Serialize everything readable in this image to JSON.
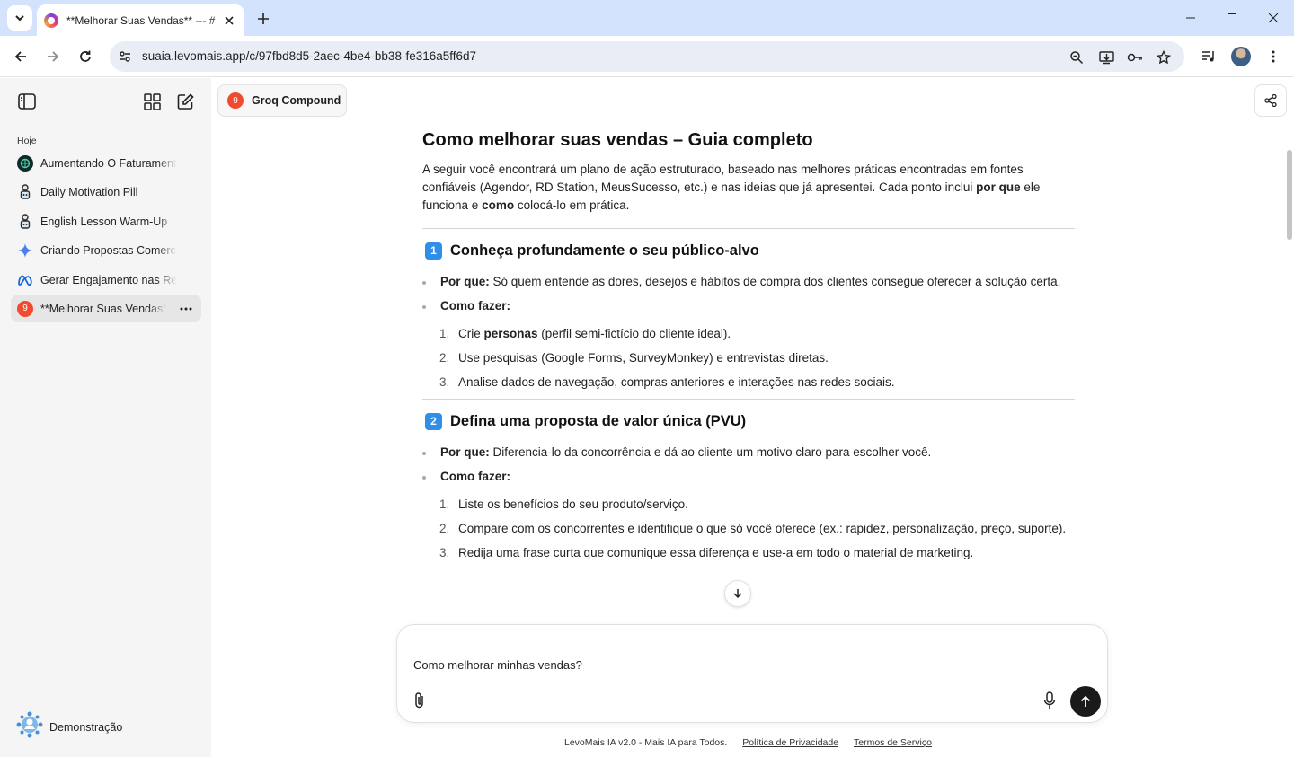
{
  "browser": {
    "tab_title": "**Melhorar Suas Vendas** --- #",
    "url": "suaia.levomais.app/c/97fbd8d5-2aec-4be4-bb38-fe316a5ff6d7"
  },
  "sidebar": {
    "section_label": "Hoje",
    "chats": [
      {
        "label": "Aumentando O Faturamento E",
        "icon": "openai-icon"
      },
      {
        "label": "Daily Motivation Pill",
        "icon": "agent-icon"
      },
      {
        "label": "English Lesson Warm-Up",
        "icon": "agent-icon"
      },
      {
        "label": "Criando Propostas Comerciais",
        "icon": "gemini-icon"
      },
      {
        "label": "Gerar Engajamento nas Redes",
        "icon": "meta-icon"
      },
      {
        "label": "**Melhorar Suas Vendas**",
        "icon": "groq-icon",
        "badge": "9"
      }
    ],
    "user_name": "Demonstração"
  },
  "main": {
    "model_badge": "9",
    "model_name": "Groq Compound"
  },
  "article": {
    "title": "Como melhorar suas vendas – Guia completo",
    "intro_part1": "A seguir você encontrará um plano de ação estruturado, baseado nas melhores práticas encontradas em fontes confiáveis (Agendor, RD Station, MeusSucesso, etc.) e nas ideias que já apresentei. Cada ponto inclui ",
    "intro_bold1": "por que",
    "intro_part2": " ele funciona e ",
    "intro_bold2": "como",
    "intro_part3": " colocá-lo em prática.",
    "sections": [
      {
        "number": "1",
        "heading": "Conheça profundamente o seu público-alvo",
        "why_label": "Por que:",
        "why_text": " Só quem entende as dores, desejos e hábitos de compra dos clientes consegue oferecer a solução certa.",
        "how_label": "Como fazer:",
        "steps": [
          {
            "n": "1.",
            "pre": "Crie ",
            "bold": "personas",
            "post": " (perfil semi-fictício do cliente ideal)."
          },
          {
            "n": "2.",
            "pre": "Use pesquisas (Google Forms, SurveyMonkey) e entrevistas diretas.",
            "bold": "",
            "post": ""
          },
          {
            "n": "3.",
            "pre": "Analise dados de navegação, compras anteriores e interações nas redes sociais.",
            "bold": "",
            "post": ""
          }
        ]
      },
      {
        "number": "2",
        "heading": "Defina uma proposta de valor única (PVU)",
        "why_label": "Por que:",
        "why_text": " Diferencia-lo da concorrência e dá ao cliente um motivo claro para escolher você.",
        "how_label": "Como fazer:",
        "steps": [
          {
            "n": "1.",
            "pre": "Liste os benefícios do seu produto/serviço.",
            "bold": "",
            "post": ""
          },
          {
            "n": "2.",
            "pre": "Compare com os concorrentes e identifique o que só você oferece (ex.: rapidez, personalização, preço, suporte).",
            "bold": "",
            "post": ""
          },
          {
            "n": "3.",
            "pre": "Redija uma frase curta que comunique essa diferença e use-a em todo o material de marketing.",
            "bold": "",
            "post": ""
          }
        ]
      }
    ]
  },
  "composer": {
    "text": "Como melhorar minhas vendas?"
  },
  "footer": {
    "brand": "LevoMais IA v2.0 - Mais IA para Todos.",
    "privacy": "Política de Privacidade",
    "terms": "Termos de Serviço"
  }
}
